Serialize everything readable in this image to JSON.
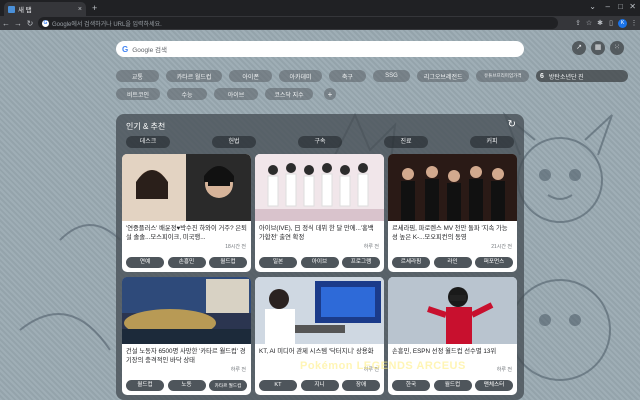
{
  "browser": {
    "tab_title": "새 탭",
    "omnibox_placeholder": "Google에서 검색하거나 URL을 입력하세요."
  },
  "search": {
    "placeholder": "Google 검색"
  },
  "shortcuts": {
    "row1": [
      "교통",
      "카타르 월드컵",
      "아이폰",
      "아카데미",
      "축구",
      "SSG",
      "리그오브레전드",
      "유튜브프리미엄가격"
    ],
    "row2": [
      "비트코인",
      "수능",
      "아이브",
      "코스닥 지수"
    ],
    "special": {
      "num": "6",
      "label": "방탄소년단 진"
    }
  },
  "trending": {
    "title": "인기 & 추천",
    "categories": [
      "데스크",
      "헌법",
      "구속",
      "진료",
      "커피"
    ],
    "cards": [
      {
        "title": "'연중플러스' 배윤정♥박수진 하와이 거주? 은퇴설 솔솔...모스피이크, 미국행...",
        "time": "18시간 전",
        "tags": [
          "연예",
          "손흥민",
          "월드컵"
        ]
      },
      {
        "title": "아이브(IVE), 日 정식 데뷔 한 달 만에...'홍백 가합전' 출연 확정",
        "time": "하루 전",
        "tags": [
          "일본",
          "아이브",
          "프로그램"
        ]
      },
      {
        "title": "르세라핌, 파로렌스 MV 천만 돌파 '지속 가능성 높은 K-...모오피컨의 동영",
        "time": "21시간 전",
        "tags": [
          "르세라핌",
          "라인",
          "퍼포먼스"
        ]
      },
      {
        "title": "건설 노동자 6500명 사망한 '카타르 월드컵' 경기장의 충격적인 바닥 상태",
        "time": "하루 전",
        "tags": [
          "월드컵",
          "노동",
          "카타르 월드컵"
        ]
      },
      {
        "title": "KT, AI 미디어 관제 시스템 '닥터지니' 상용화",
        "time": "하루 전",
        "tags": [
          "KT",
          "지니",
          "장애"
        ]
      },
      {
        "title": "손흥민, ESPN 선정 월드컵 선수별 13위",
        "time": "하루 전",
        "tags": [
          "한국",
          "월드컵",
          "맨체스터"
        ]
      }
    ]
  },
  "overlay": "Pokémon LEGENDS ARCEUS",
  "colors": {
    "panel": "#464e54",
    "accent": "#1a73e8",
    "background": "#9aaab2"
  }
}
